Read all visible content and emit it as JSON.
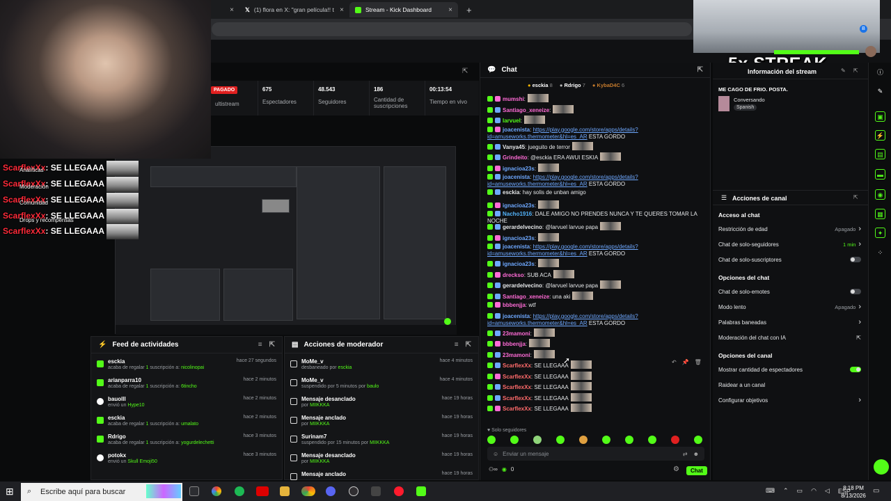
{
  "browser": {
    "tabs": [
      {
        "label": "(1) flora en X: \"gran película!! t",
        "close": "×"
      },
      {
        "label": "Stream - Kick Dashboard",
        "close": "×"
      }
    ],
    "new_tab": "+"
  },
  "overlay": {
    "streak": "5x STREAK",
    "chat_lines": [
      {
        "user": "ScarflexXx",
        "text": ": SE LLEGAAA"
      },
      {
        "user": "ScarflexXx",
        "text": ": SE LLEGAAA"
      },
      {
        "user": "ScarflexXx",
        "text": ": SE LLEGAAA"
      },
      {
        "user": "ScarflexXx",
        "text": ": SE LLEGAAA"
      },
      {
        "user": "ScarflexXx",
        "text": ": SE LLEGAAA"
      }
    ],
    "left_menu": [
      "Analíticas",
      "Moderación",
      "Comunidad",
      "Drops y recompensas"
    ]
  },
  "stats": {
    "badge": "PAGADO",
    "multistream": "ultistream",
    "items": [
      {
        "value": "675",
        "label": "Espectadores"
      },
      {
        "value": "48.543",
        "label": "Seguidores"
      },
      {
        "value": "186",
        "label": "Cantidad de suscripciones"
      },
      {
        "value": "00:13:54",
        "label": "Tiempo en vivo"
      }
    ]
  },
  "feed": {
    "title": "Feed de actividades",
    "items": [
      {
        "name": "esckia",
        "desc1": "acaba de regalar ",
        "count": "1",
        "desc2": " suscripción a: ",
        "target": "nicolinopai",
        "time": "hace 27 segundos"
      },
      {
        "name": "arianparra10",
        "desc1": "acaba de regalar ",
        "count": "1",
        "desc2": " suscripción a: ",
        "target": "6tincho",
        "time": "hace 2 minutos"
      },
      {
        "name": "bauolll",
        "desc1": "envió un ",
        "count": "Hype",
        "desc2": "",
        "target": "10",
        "time": "hace 2 minutos"
      },
      {
        "name": "esckia",
        "desc1": "acaba de regalar ",
        "count": "1",
        "desc2": " suscripción a: ",
        "target": "umalato",
        "time": "hace 2 minutos"
      },
      {
        "name": "Rdrigo",
        "desc1": "acaba de regalar ",
        "count": "1",
        "desc2": " suscripción a: ",
        "target": "yogurdelechetti",
        "time": "hace 3 minutos"
      },
      {
        "name": "potokx",
        "desc1": "envió un ",
        "count": "Skull Emoji",
        "desc2": "",
        "target": "50",
        "time": "hace 3 minutos"
      }
    ]
  },
  "modactions": {
    "title": "Acciones de moderador",
    "items": [
      {
        "name": "MoMe_v",
        "desc": "desbaneado por ",
        "by": "esckia",
        "time": "hace 4 minutos"
      },
      {
        "name": "MoMe_v",
        "desc": "suspendido por 5 minutos por ",
        "by": "baulo",
        "time": "hace 4 minutos"
      },
      {
        "name": "Mensaje desanclado",
        "desc": "por ",
        "by": "MIIKKKA",
        "time": "hace 19 horas"
      },
      {
        "name": "Mensaje anclado",
        "desc": "por ",
        "by": "MIIKKKA",
        "time": "hace 19 horas"
      },
      {
        "name": "Surinam7",
        "desc": "suspendido por 15 minutos por ",
        "by": "MIIKKKA",
        "time": "hace 19 horas"
      },
      {
        "name": "Mensaje desanclado",
        "desc": "por ",
        "by": "MIIKKKA",
        "time": "hace 19 horas"
      },
      {
        "name": "Mensaje anclado",
        "desc": "",
        "by": "",
        "time": "hace 19 horas"
      }
    ]
  },
  "chat": {
    "title": "Chat",
    "top_gifters": [
      {
        "name": "esckia",
        "count": "8"
      },
      {
        "name": "Rdrigo",
        "count": "7"
      },
      {
        "name": "KybaD4C",
        "count": "6"
      }
    ],
    "messages": [
      {
        "user": "mumshi",
        "color": "#ff6bd6",
        "text": ":",
        "link": "",
        "after": "",
        "emote": true
      },
      {
        "user": "Santiago_xeneize",
        "color": "#ff6bd6",
        "text": ":",
        "link": "",
        "after": "",
        "emote": true
      },
      {
        "user": "larvuel",
        "color": "#53fc18",
        "text": ":",
        "link": "",
        "after": "",
        "emote": true
      },
      {
        "user": "joacenista",
        "color": "#6ea8ff",
        "text": ": ",
        "link": "https://play.google.com/store/apps/details?id=amuseworks.thermometer&hl=es_AR",
        "after": " ESTA GORDO",
        "emote": false
      },
      {
        "user": "Vanya45",
        "color": "#e6e8ea",
        "text": ": jueguito de terror",
        "link": "",
        "after": "",
        "emote": true
      },
      {
        "user": "Grindeito",
        "color": "#ff6bd6",
        "text": ": @esckia ERA AWUI ESKIA",
        "link": "",
        "after": "",
        "emote": true
      },
      {
        "user": "ignacioa23s",
        "color": "#6ea8ff",
        "text": ":",
        "link": "",
        "after": "",
        "emote": true
      },
      {
        "user": "joacenista",
        "color": "#6ea8ff",
        "text": ": ",
        "link": "https://play.google.com/store/apps/details?id=amuseworks.thermometer&hl=es_AR",
        "after": " ESTA GORDO",
        "emote": false
      },
      {
        "user": "esckia",
        "color": "#e6e8ea",
        "text": ": hay solis de unban amigo",
        "link": "",
        "after": "",
        "emote": false
      },
      {
        "user": "ignacioa23s",
        "color": "#6ea8ff",
        "text": ":",
        "link": "",
        "after": "",
        "emote": true
      },
      {
        "user": "Nacho1916",
        "color": "#53b4fc",
        "text": ": DALE AMIGO NO PRENDES NUNCA Y TE QUERES TOMAR LA NOCHE",
        "link": "",
        "after": "",
        "emote": false
      },
      {
        "user": "gerardelvecino",
        "color": "#e6e8ea",
        "text": ": @larvuel larvue papa",
        "link": "",
        "after": "",
        "emote": true
      },
      {
        "user": "ignacioa23s",
        "color": "#6ea8ff",
        "text": ":",
        "link": "",
        "after": "",
        "emote": true
      },
      {
        "user": "joacenista",
        "color": "#6ea8ff",
        "text": ": ",
        "link": "https://play.google.com/store/apps/details?id=amuseworks.thermometer&hl=es_AR",
        "after": " ESTA GORDO",
        "emote": false
      },
      {
        "user": "ignacioa23s",
        "color": "#6ea8ff",
        "text": ":",
        "link": "",
        "after": "",
        "emote": true
      },
      {
        "user": "dreckso",
        "color": "#ff6bd6",
        "text": ": SUB ACA",
        "link": "",
        "after": "",
        "emote": true
      },
      {
        "user": "gerardelvecino",
        "color": "#e6e8ea",
        "text": ": @larvuel larvue papa",
        "link": "",
        "after": "",
        "emote": true
      },
      {
        "user": "Santiago_xeneize",
        "color": "#ff6bd6",
        "text": ": una aki",
        "link": "",
        "after": "",
        "emote": true
      },
      {
        "user": "bbbenjja",
        "color": "#ff6bd6",
        "text": ": wtf",
        "link": "",
        "after": "",
        "emote": false
      },
      {
        "user": "joacenista",
        "color": "#6ea8ff",
        "text": ": ",
        "link": "https://play.google.com/store/apps/details?id=amuseworks.thermometer&hl=es_AR",
        "after": " ESTA GORDO",
        "emote": false
      },
      {
        "user": "23mamoni",
        "color": "#ff6bd6",
        "text": ":",
        "link": "",
        "after": "",
        "emote": true
      },
      {
        "user": "bbbenjja",
        "color": "#ff6bd6",
        "text": ":",
        "link": "",
        "after": "",
        "emote": true
      },
      {
        "user": "23mamoni",
        "color": "#ff6bd6",
        "text": ":",
        "link": "",
        "after": "",
        "emote": true
      },
      {
        "user": "ScarflexXx",
        "color": "#ff6b6b",
        "text": ": SE LLEGAAA",
        "link": "",
        "after": "",
        "emote": true
      },
      {
        "user": "ScarflexXx",
        "color": "#ff6b6b",
        "text": ": SE LLEGAAA",
        "link": "",
        "after": "",
        "emote": true
      },
      {
        "user": "ScarflexXx",
        "color": "#ff6b6b",
        "text": ": SE LLEGAAA",
        "link": "",
        "after": "",
        "emote": true
      },
      {
        "user": "ScarflexXx",
        "color": "#ff6b6b",
        "text": ": SE LLEGAAA",
        "link": "",
        "after": "",
        "emote": true
      },
      {
        "user": "ScarflexXx",
        "color": "#ff6b6b",
        "text": ": SE LLEGAAA",
        "link": "",
        "after": "",
        "emote": true
      }
    ],
    "mode": "Solo seguidores",
    "input_placeholder": "Enviar un mensaje",
    "send_label": "Chat",
    "points": "0"
  },
  "streaminfo": {
    "title_short": "Información del stream",
    "stream_title": "ME CAGO DE FRIO. POSTA.",
    "category": "Conversando",
    "language": "Spanish"
  },
  "channel": {
    "title": "Acciones de canal",
    "sections": [
      {
        "heading": "Acceso al chat",
        "rows": [
          {
            "label": "Restricción de edad",
            "value": "Apagado",
            "kind": "arrow"
          },
          {
            "label": "Chat de solo-seguidores",
            "value": "1 min",
            "kind": "arrow"
          },
          {
            "label": "Chat de solo-suscriptores",
            "value": "",
            "kind": "toggle-off"
          }
        ]
      },
      {
        "heading": "Opciones del chat",
        "rows": [
          {
            "label": "Chat de solo-emotes",
            "value": "",
            "kind": "toggle-off"
          },
          {
            "label": "Modo lento",
            "value": "Apagado",
            "kind": "arrow"
          },
          {
            "label": "Palabras baneadas",
            "value": "",
            "kind": "arrow"
          },
          {
            "label": "Moderación del chat con IA",
            "value": "",
            "kind": "ext"
          }
        ]
      },
      {
        "heading": "Opciones del canal",
        "rows": [
          {
            "label": "Mostrar cantidad de espectadores",
            "value": "",
            "kind": "toggle-on"
          },
          {
            "label": "Raidear a un canal",
            "value": "",
            "kind": "none"
          },
          {
            "label": "Configurar objetivos",
            "value": "",
            "kind": "arrow"
          }
        ]
      }
    ]
  },
  "taskbar": {
    "search_placeholder": "Escribe aquí para buscar",
    "lang": "ESP",
    "time": "8:18 PM",
    "date": "8/13/2026"
  },
  "colors": {
    "kick_green": "#53fc18",
    "bg": "#0f1012",
    "panel": "#141517",
    "red": "#e02020"
  }
}
